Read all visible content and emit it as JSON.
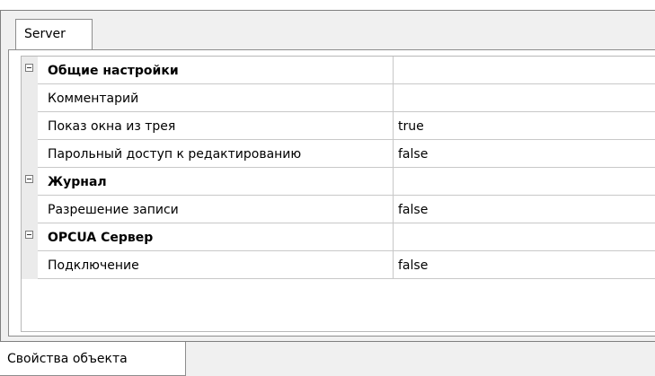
{
  "tabs": {
    "server_label": "Server"
  },
  "grid": {
    "rows": [
      {
        "kind": "category",
        "name": "Общие настройки",
        "value": ""
      },
      {
        "kind": "property",
        "name": "Комментарий",
        "value": ""
      },
      {
        "kind": "property",
        "name": "Показ окна из трея",
        "value": "true"
      },
      {
        "kind": "property",
        "name": "Парольный доступ к редактированию",
        "value": "false"
      },
      {
        "kind": "category",
        "name": "Журнал",
        "value": ""
      },
      {
        "kind": "property",
        "name": "Разрешение записи",
        "value": "false"
      },
      {
        "kind": "category",
        "name": "OPCUA Сервер",
        "value": ""
      },
      {
        "kind": "property",
        "name": "Подключение",
        "value": "false"
      }
    ]
  },
  "bottom_tabs": {
    "properties_label": "Свойства объекта"
  },
  "icons": {
    "category_toggle": "collapse-minus-icon"
  }
}
